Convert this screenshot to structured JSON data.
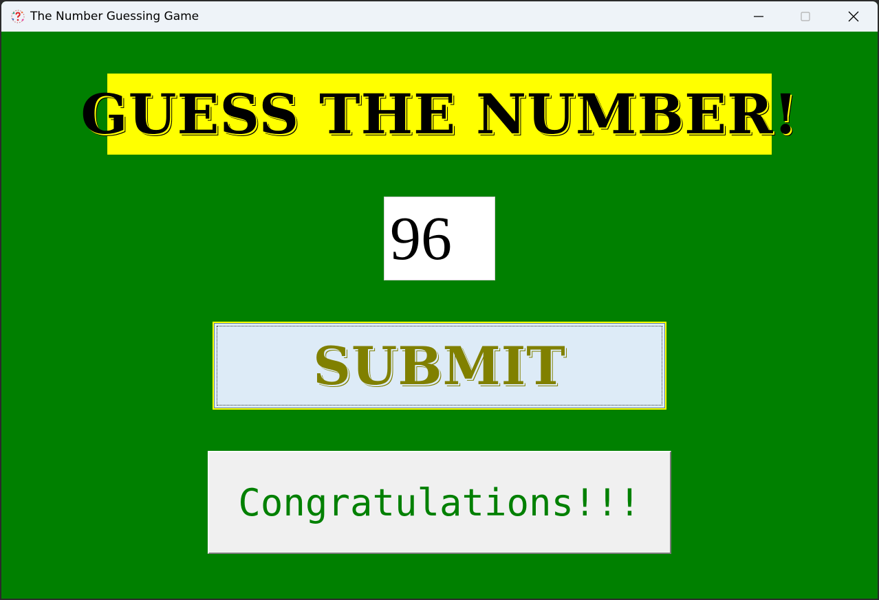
{
  "window": {
    "title": "The Number Guessing Game",
    "app_icon": "question-mark-dots-icon",
    "controls": [
      "minimize-icon",
      "maximize-icon",
      "close-icon"
    ]
  },
  "game": {
    "heading": "GUESS THE NUMBER!",
    "guess_value": "96",
    "submit_label": "SUBMIT",
    "result_message": "Congratulations!!!"
  },
  "colors": {
    "background": "#008000",
    "heading_bg": "#ffff00",
    "submit_text": "#808000",
    "result_text": "#008000"
  }
}
